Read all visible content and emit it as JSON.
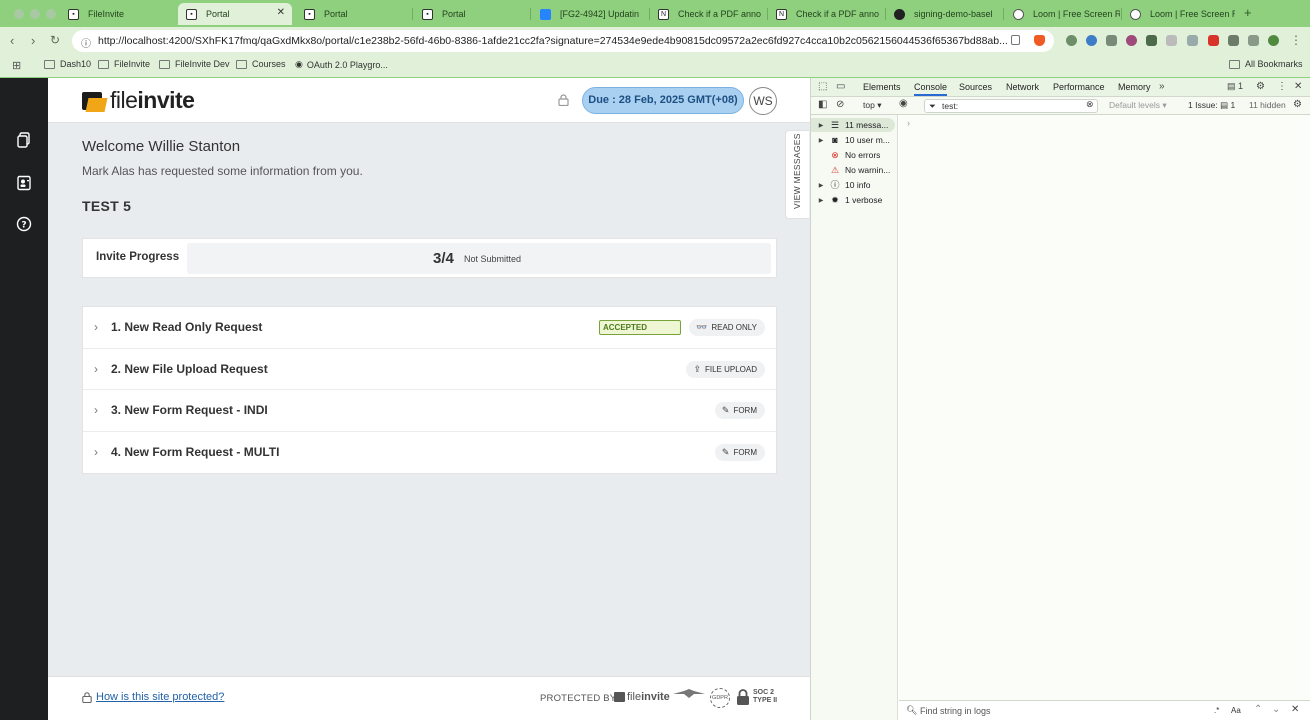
{
  "browser": {
    "tabs": [
      {
        "title": "FileInvite",
        "active": false
      },
      {
        "title": "Portal",
        "active": true
      },
      {
        "title": "Portal",
        "active": false
      },
      {
        "title": "Portal",
        "active": false
      },
      {
        "title": "[FG2-4942] Updatin",
        "active": false
      },
      {
        "title": "Check if a PDF anno",
        "active": false
      },
      {
        "title": "Check if a PDF anno",
        "active": false
      },
      {
        "title": "signing-demo-basel",
        "active": false
      },
      {
        "title": "Loom | Free Screen R",
        "active": false
      },
      {
        "title": "Loom | Free Screen R",
        "active": false
      }
    ],
    "url": "http://localhost:4200/SXhFK17fmq/qaGxdMkx8o/portal/c1e238b2-56fd-46b0-8386-1afde21cc2fa?signature=274534e9ede4b90815dc09572a2ec6fd927c4cca10b2c0562156044536f65367bd88ab...",
    "bookmarks": [
      "Dash10",
      "FileInvite",
      "FileInvite Dev",
      "Courses",
      "OAuth 2.0 Playgro..."
    ],
    "all_bookmarks": "All Bookmarks"
  },
  "portal": {
    "logo_light": "file",
    "logo_bold": "invite",
    "due_label": "Due : 28 Feb, 2025 ",
    "due_tz": "GMT(+08)",
    "avatar": "WS",
    "welcome": "Welcome Willie Stanton",
    "subtitle": "Mark Alas has requested some information from you.",
    "invite_title": "TEST 5",
    "progress": {
      "label": "Invite Progress",
      "count": "3/4",
      "fraction": 0.75,
      "status": "Not Submitted"
    },
    "view_messages": "VIEW MESSAGES",
    "requests": [
      {
        "title": "1. New Read Only Request",
        "badge": "ACCEPTED",
        "type": "READ ONLY",
        "icon": "glasses-icon"
      },
      {
        "title": "2. New File Upload Request",
        "badge": "",
        "type": "FILE UPLOAD",
        "icon": "upload-icon"
      },
      {
        "title": "3. New Form Request - INDI",
        "badge": "",
        "type": "FORM",
        "icon": "pencil-icon"
      },
      {
        "title": "4. New Form Request - MULTI",
        "badge": "",
        "type": "FORM",
        "icon": "pencil-icon"
      }
    ],
    "footer": {
      "link": "How is this site protected?",
      "protected_by": "PROTECTED BY",
      "logo_light": "file",
      "logo_bold": "invite",
      "gdpr": "GDPR",
      "soc_line1": "SOC 2",
      "soc_line2": "TYPE II"
    }
  },
  "devtools": {
    "tabs": [
      "Elements",
      "Console",
      "Sources",
      "Network",
      "Performance",
      "Memory"
    ],
    "active_tab": "Console",
    "context": "top",
    "filter": "test:",
    "levels": "Default levels",
    "issues_label": "1 Issue:",
    "issues_count": "1",
    "hidden": "11 hidden",
    "badge_count": "1",
    "sidebar": [
      {
        "label": "11 messa...",
        "icon": "list-icon"
      },
      {
        "label": "10 user m...",
        "icon": "user-icon"
      },
      {
        "label": "No errors",
        "icon": "error-icon"
      },
      {
        "label": "No warnin...",
        "icon": "warning-icon"
      },
      {
        "label": "10 info",
        "icon": "info-icon"
      },
      {
        "label": "1 verbose",
        "icon": "bug-icon"
      }
    ],
    "find_placeholder": "Find string in logs",
    "find_opts": ".*",
    "find_case": "Aa"
  },
  "colors": {
    "browser_frame": "#8fd07f",
    "due_bg": "#a9d0f1",
    "accepted_border": "#75a33a",
    "logo_accent": "#f0a616"
  }
}
